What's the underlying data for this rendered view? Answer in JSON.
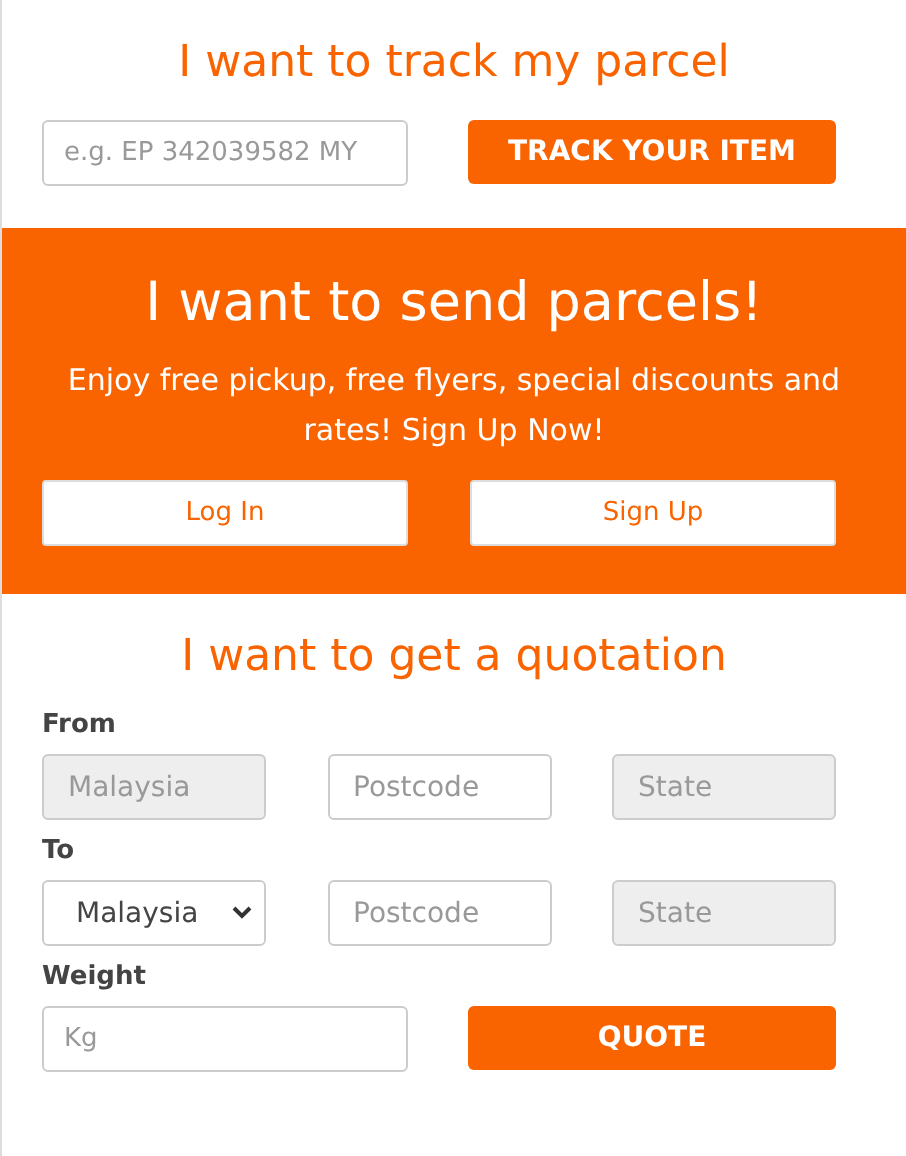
{
  "track": {
    "title": "I want to track my parcel",
    "field": {
      "placeholder": "e.g. EP 342039582 MY"
    },
    "button": "TRACK YOUR ITEM"
  },
  "send": {
    "title": "I want to send parcels!",
    "text": "Enjoy free pickup, free flyers, special discounts and rates! Sign Up Now!",
    "buttons": [
      "Log In",
      "Sign Up"
    ]
  },
  "quotation": {
    "title": "I want to get a quotation",
    "groups": [
      {
        "label": "From",
        "fields": [
          {
            "kind": "input",
            "placeholder": "Malaysia",
            "disabled": true
          },
          {
            "kind": "input",
            "placeholder": "Postcode",
            "disabled": false
          },
          {
            "kind": "input",
            "placeholder": "State",
            "disabled": true
          }
        ]
      },
      {
        "label": "To",
        "fields": [
          {
            "kind": "select",
            "value": "Malaysia",
            "disabled": false
          },
          {
            "kind": "input",
            "placeholder": "Postcode",
            "disabled": false
          },
          {
            "kind": "input",
            "placeholder": "State",
            "disabled": true
          }
        ]
      }
    ],
    "weight": {
      "label": "Weight",
      "placeholder": "Kg"
    },
    "button": "QUOTE"
  }
}
